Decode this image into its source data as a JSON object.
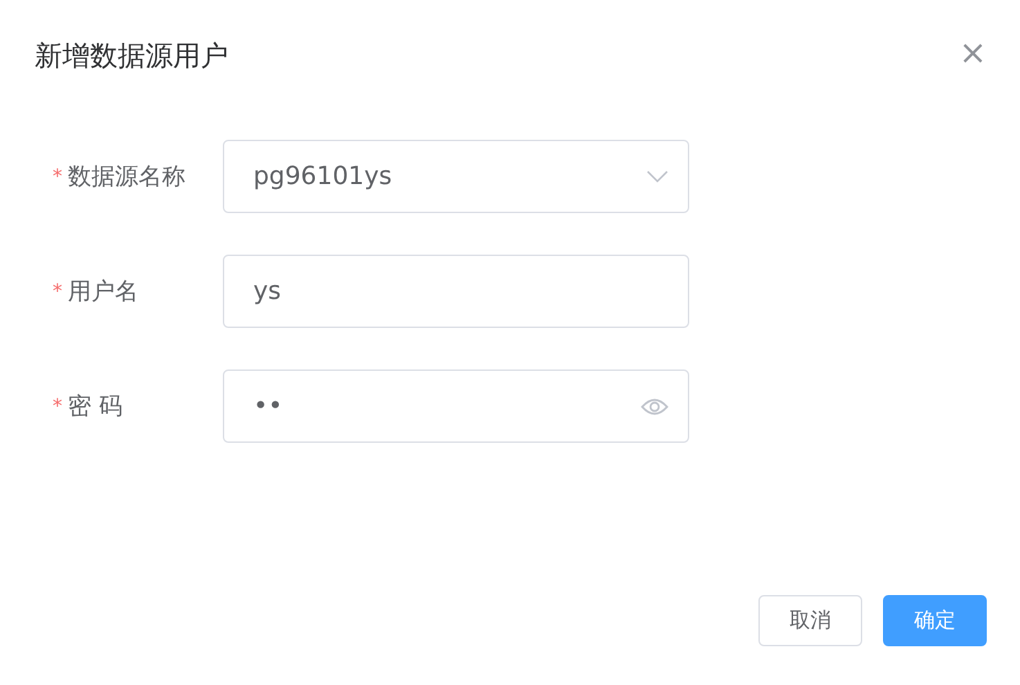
{
  "dialog": {
    "title": "新增数据源用户",
    "close": "×"
  },
  "fields": [
    {
      "kind": "select",
      "required": true,
      "required_mark": "*",
      "label": "数据源名称",
      "value": "pg96101ys"
    },
    {
      "kind": "text",
      "required": true,
      "required_mark": "*",
      "label": "用户名",
      "value": "ys"
    },
    {
      "kind": "password",
      "required": true,
      "required_mark": "*",
      "label": "密 码",
      "value": "••"
    }
  ],
  "buttons": [
    {
      "label": "取消",
      "kind": "default"
    },
    {
      "label": "确定",
      "kind": "primary"
    }
  ]
}
